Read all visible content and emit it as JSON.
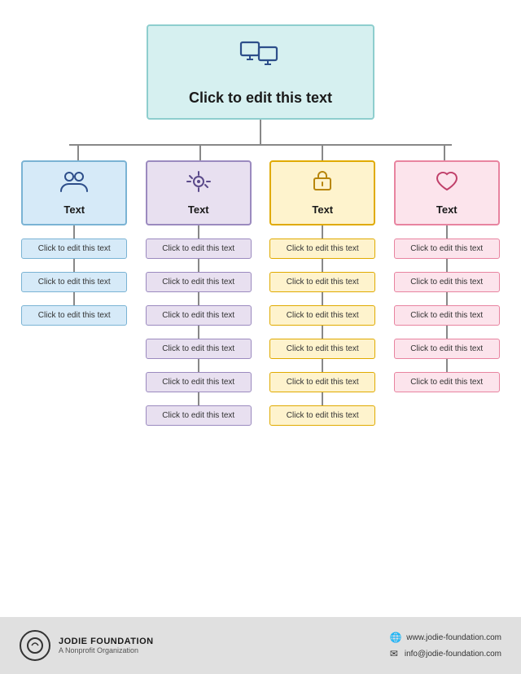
{
  "root": {
    "title": "Click to edit this text",
    "icon": "🖥"
  },
  "columns": [
    {
      "id": "blue",
      "header_title": "Text",
      "header_icon": "👥",
      "color_class": "col-blue",
      "child_class": "child-blue",
      "children": [
        "Click to edit this text",
        "Click to edit this text",
        "Click to edit this text"
      ]
    },
    {
      "id": "purple",
      "header_title": "Text",
      "header_icon": "⚙️",
      "color_class": "col-purple",
      "child_class": "child-purple",
      "children": [
        "Click to edit this text",
        "Click to edit this text",
        "Click to edit this text",
        "Click to edit this text",
        "Click to edit this text",
        "Click to edit this text"
      ]
    },
    {
      "id": "yellow",
      "header_title": "Text",
      "header_icon": "💼",
      "color_class": "col-yellow",
      "child_class": "child-yellow",
      "children": [
        "Click to edit this text",
        "Click to edit this text",
        "Click to edit this text",
        "Click to edit this text",
        "Click to edit this text",
        "Click to edit this text"
      ]
    },
    {
      "id": "pink",
      "header_title": "Text",
      "header_icon": "🤍",
      "color_class": "col-pink",
      "child_class": "child-pink",
      "children": [
        "Click to edit this text",
        "Click to edit this text",
        "Click to edit this text",
        "Click to edit this text",
        "Click to edit this text"
      ]
    }
  ],
  "footer": {
    "org_name": "JODIE FOUNDATION",
    "org_sub": "A Nonprofit Organization",
    "website": "www.jodie-foundation.com",
    "email": "info@jodie-foundation.com"
  }
}
